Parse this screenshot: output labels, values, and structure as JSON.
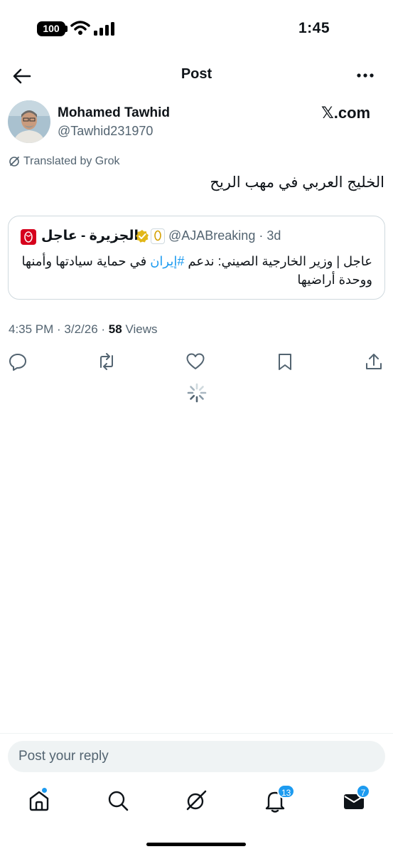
{
  "status_bar": {
    "battery": "100",
    "time": "1:45"
  },
  "header": {
    "title": "Post"
  },
  "post": {
    "author_name": "Mohamed Tawhid",
    "author_handle": "@Tawhid231970",
    "source_label": "𝕏.com",
    "translated_label": "Translated by Grok",
    "text": "الخليج العربي في مهب الريح",
    "timestamp": "4:35 PM · 3/2/26 · ",
    "views_count": "58",
    "views_label": " Views"
  },
  "quote": {
    "name": "الجزيرة - عاجل",
    "handle": "@AJABreaking",
    "age": " · 3d",
    "text_before": "عاجل | وزير الخارجية الصيني: ندعم ",
    "hashtag": "#إيران",
    "text_after": " في حماية سيادتها وأمنها ووحدة أراضيها"
  },
  "reply": {
    "placeholder": "Post your reply"
  },
  "tabs": {
    "notifications_badge": "13",
    "messages_badge": "7"
  },
  "colors": {
    "accent": "#1d9bf0",
    "secondary_text": "#536471",
    "border": "#cfd9de"
  },
  "icons": [
    "back-arrow-icon",
    "more-icon",
    "reply-icon",
    "repost-icon",
    "like-icon",
    "bookmark-icon",
    "share-icon",
    "home-icon",
    "search-icon",
    "grok-icon",
    "notifications-icon",
    "messages-icon"
  ]
}
